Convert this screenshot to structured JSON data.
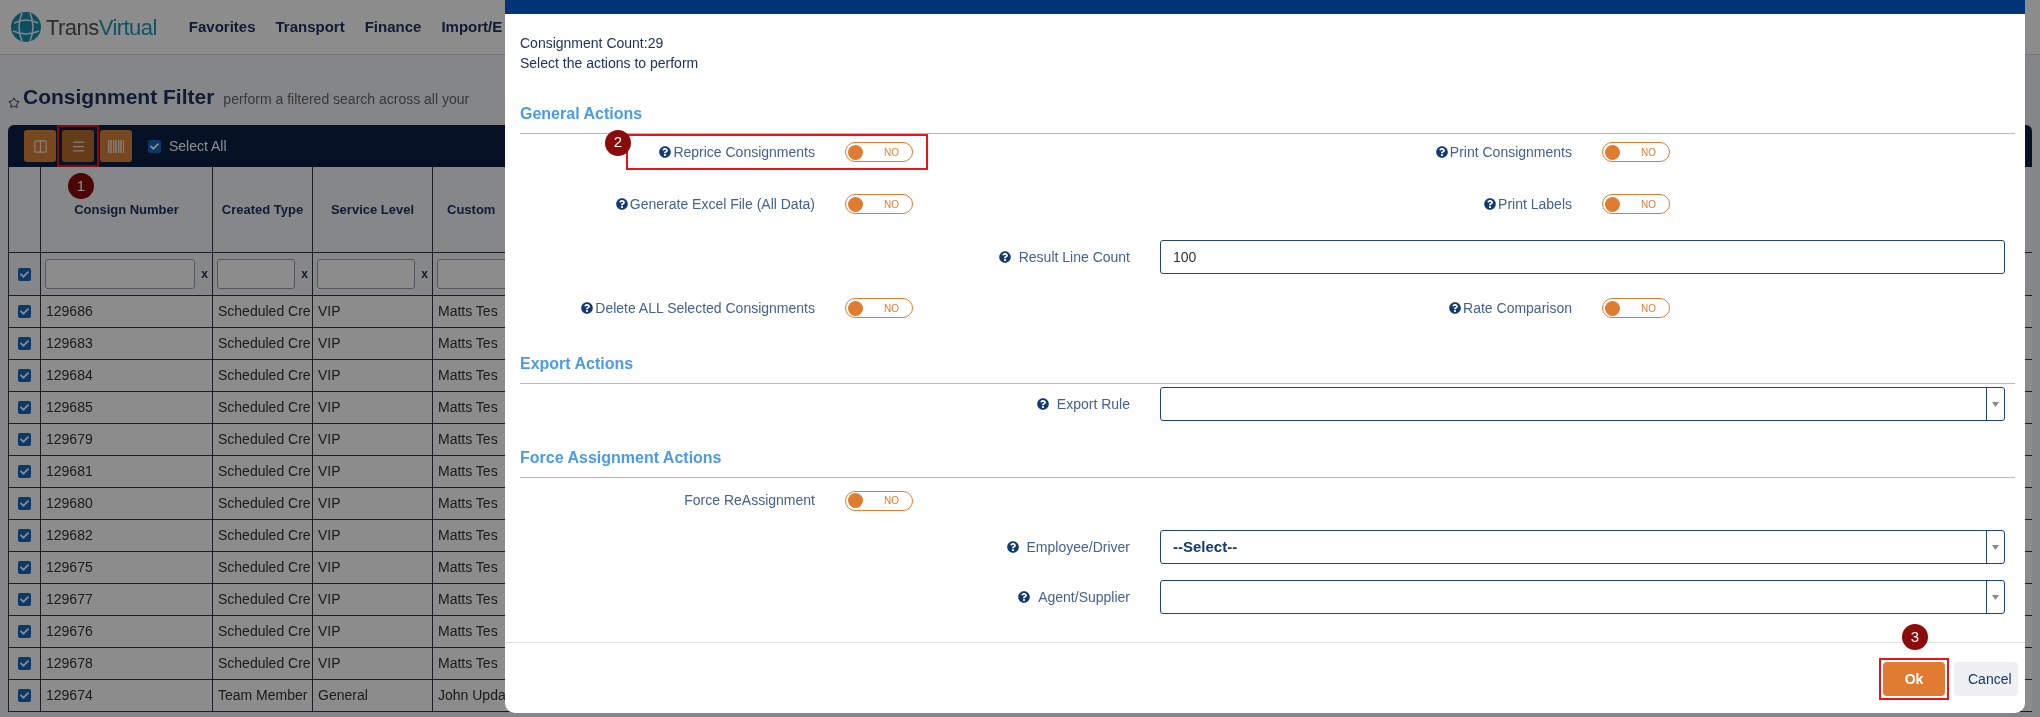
{
  "app": {
    "logo_parts": [
      "Trans",
      "Virtual"
    ],
    "nav": [
      "Favorites",
      "Transport",
      "Finance",
      "Import/E"
    ]
  },
  "page": {
    "title": "Consignment Filter",
    "subtitle": "perform a filtered search across all your"
  },
  "toolbar": {
    "buttons": [
      {
        "kind": "columns",
        "highlighted": false
      },
      {
        "kind": "list",
        "highlighted": true,
        "callout": "1"
      },
      {
        "kind": "barcode",
        "highlighted": false
      }
    ],
    "select_all": {
      "label": "Select All",
      "checked": true
    }
  },
  "table": {
    "columns": [
      "Consign Number",
      "Created Type",
      "Service Level",
      "Custom"
    ],
    "filter_row": {
      "checked": true,
      "clear": [
        "x",
        "x",
        "x"
      ]
    },
    "rows": [
      {
        "checked": true,
        "cells": [
          "129686",
          "Scheduled Cre",
          "VIP",
          "Matts Tes"
        ]
      },
      {
        "checked": true,
        "cells": [
          "129683",
          "Scheduled Cre",
          "VIP",
          "Matts Tes"
        ]
      },
      {
        "checked": true,
        "cells": [
          "129684",
          "Scheduled Cre",
          "VIP",
          "Matts Tes"
        ]
      },
      {
        "checked": true,
        "cells": [
          "129685",
          "Scheduled Cre",
          "VIP",
          "Matts Tes"
        ]
      },
      {
        "checked": true,
        "cells": [
          "129679",
          "Scheduled Cre",
          "VIP",
          "Matts Tes"
        ]
      },
      {
        "checked": true,
        "cells": [
          "129681",
          "Scheduled Cre",
          "VIP",
          "Matts Tes"
        ]
      },
      {
        "checked": true,
        "cells": [
          "129680",
          "Scheduled Cre",
          "VIP",
          "Matts Tes"
        ]
      },
      {
        "checked": true,
        "cells": [
          "129682",
          "Scheduled Cre",
          "VIP",
          "Matts Tes"
        ]
      },
      {
        "checked": true,
        "cells": [
          "129675",
          "Scheduled Cre",
          "VIP",
          "Matts Tes"
        ]
      },
      {
        "checked": true,
        "cells": [
          "129677",
          "Scheduled Cre",
          "VIP",
          "Matts Tes"
        ]
      },
      {
        "checked": true,
        "cells": [
          "129676",
          "Scheduled Cre",
          "VIP",
          "Matts Tes"
        ]
      },
      {
        "checked": true,
        "cells": [
          "129678",
          "Scheduled Cre",
          "VIP",
          "Matts Tes"
        ]
      },
      {
        "checked": true,
        "cells": [
          "129674",
          "Team Member",
          "General",
          "John Upda"
        ]
      }
    ]
  },
  "dialog": {
    "count": "Consignment Count:29",
    "instruction": "Select the actions to perform",
    "sections": [
      {
        "title": "General Actions",
        "rows": [
          {
            "cells": [
              {
                "kind": "toggle",
                "label": "Reprice Consignments",
                "help": true,
                "on": false,
                "state_text": "NO",
                "highlighted": true,
                "callout": "2"
              },
              {
                "kind": "toggle",
                "label": "Print Consignments",
                "help": true,
                "on": false,
                "state_text": "NO",
                "highlighted": false
              }
            ]
          },
          {
            "cells": [
              {
                "kind": "toggle",
                "label": "Generate Excel File (All Data)",
                "help": true,
                "on": false,
                "state_text": "NO",
                "highlighted": false
              },
              {
                "kind": "toggle",
                "label": "Print Labels",
                "help": true,
                "on": false,
                "state_text": "NO",
                "highlighted": false
              }
            ]
          },
          {
            "cells": [
              {
                "kind": "input",
                "label": "Result Line Count",
                "help": true,
                "value": "100"
              }
            ]
          },
          {
            "cells": [
              {
                "kind": "toggle",
                "label": "Delete ALL Selected Consignments",
                "help": true,
                "on": false,
                "state_text": "NO",
                "highlighted": false
              },
              {
                "kind": "toggle",
                "label": "Rate Comparison",
                "help": true,
                "on": false,
                "state_text": "NO",
                "highlighted": false
              }
            ]
          }
        ]
      },
      {
        "title": "Export Actions",
        "rows": [
          {
            "cells": [
              {
                "kind": "select",
                "label": "Export Rule",
                "help": true
              }
            ]
          }
        ]
      },
      {
        "title": "Force Assignment Actions",
        "rows": [
          {
            "cells": [
              {
                "kind": "toggle",
                "label": "Force ReAssignment",
                "help": false,
                "on": false,
                "state_text": "NO",
                "highlighted": false
              }
            ]
          },
          {
            "cells": [
              {
                "kind": "select",
                "label": "Employee/Driver",
                "help": true,
                "value": "--Select--"
              }
            ]
          },
          {
            "cells": [
              {
                "kind": "select",
                "label": "Agent/Supplier",
                "help": true
              }
            ]
          }
        ]
      }
    ],
    "buttons": [
      {
        "kind": "primary",
        "label": "Ok",
        "highlighted": true,
        "callout": "3"
      },
      {
        "kind": "secondary",
        "label": "Cancel",
        "highlighted": false
      }
    ]
  }
}
